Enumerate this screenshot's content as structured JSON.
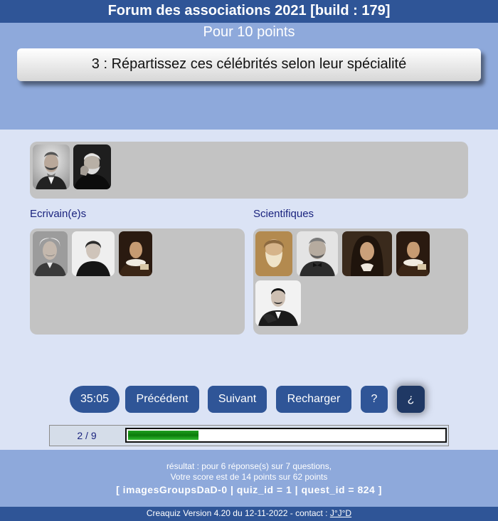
{
  "header": {
    "title": "Forum des associations 2021 [build : 179]",
    "points": "Pour 10 points",
    "question": "3 : Répartissez ces célébrités selon leur spécialité"
  },
  "pool": {
    "images": [
      {
        "name": "portrait-man-mustache"
      },
      {
        "name": "portrait-man-beard-thinking"
      }
    ]
  },
  "groups": [
    {
      "label": "Ecrivain(e)s",
      "images": [
        {
          "name": "portrait-einstein"
        },
        {
          "name": "portrait-woman-dark-dress"
        },
        {
          "name": "portrait-man-ruff-collar"
        }
      ]
    },
    {
      "label": "Scientifiques",
      "images": [
        {
          "name": "portrait-old-man-long-beard"
        },
        {
          "name": "portrait-man-bow-tie"
        },
        {
          "name": "portrait-man-long-wig"
        },
        {
          "name": "portrait-man-ruff-collar-2"
        },
        {
          "name": "portrait-man-mustache-pose"
        }
      ]
    }
  ],
  "controls": {
    "timer": "35:05",
    "previous": "Précédent",
    "next": "Suivant",
    "reload": "Recharger",
    "help": "?",
    "help_inverted": "¿"
  },
  "progress": {
    "label": "2 / 9",
    "fraction": 0.2222
  },
  "result": {
    "line1": "résultat : pour 6 réponse(s) sur 7 questions,",
    "line2": "Votre score est de 14 points sur 62 points",
    "ids": "[ imagesGroupsDaD-0 | quiz_id = 1 | quest_id = 824 ]"
  },
  "footer": {
    "text": "Creaquiz Version 4.20 du 12-11-2022 - contact : ",
    "contact": "J°J°D"
  },
  "colors": {
    "primary": "#2f5597",
    "band": "#8ea9db",
    "background": "#dbe3f5",
    "box": "#c3c3c3",
    "progress": "#0b7a0b"
  }
}
